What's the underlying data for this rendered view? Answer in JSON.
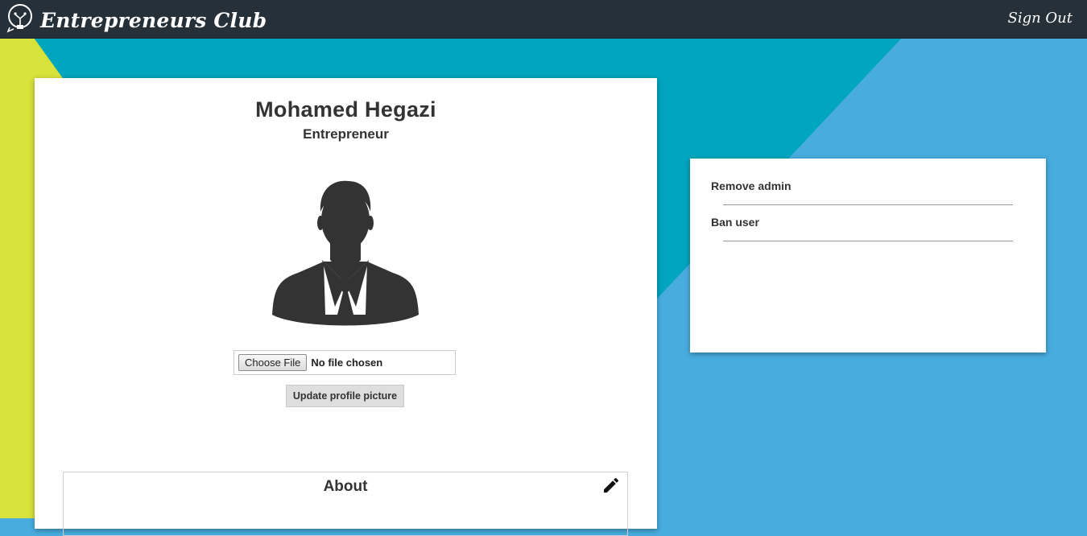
{
  "navbar": {
    "brand_title": "Entrepreneurs Club",
    "signout_label": "Sign Out",
    "brand_icon": "lightbulb-icon"
  },
  "profile": {
    "name": "Mohamed Hegazi",
    "role": "Entrepreneur",
    "avatar_icon": "user-silhouette-icon",
    "file_input": {
      "button_label": "Choose File",
      "status_text": "No file chosen"
    },
    "update_button_label": "Update profile picture",
    "about": {
      "title": "About",
      "edit_icon": "pencil-icon"
    }
  },
  "admin_actions": {
    "items": [
      {
        "label": "Remove admin"
      },
      {
        "label": "Ban user"
      }
    ]
  },
  "colors": {
    "navbar": "#263038",
    "yellow": "#d7e23a",
    "teal": "#00a5be",
    "blue": "#48acdf"
  }
}
